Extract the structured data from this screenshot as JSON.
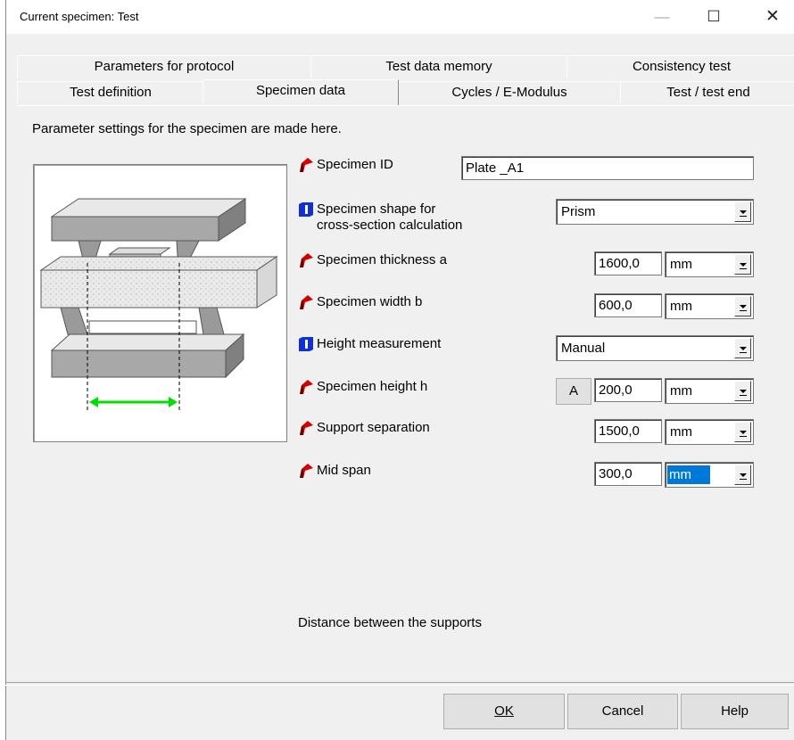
{
  "window": {
    "title": "Current specimen: Test"
  },
  "tabs_back": [
    {
      "label": "Parameters for protocol"
    },
    {
      "label": "Test data memory"
    },
    {
      "label": "Consistency test"
    }
  ],
  "tabs_front": [
    {
      "label": "Test definition"
    },
    {
      "label": "Specimen data"
    },
    {
      "label": "Cycles / E-Modulus"
    },
    {
      "label": "Test / test end"
    }
  ],
  "intro": "Parameter settings for the specimen are made here.",
  "fields": {
    "specimen_id": {
      "label": "Specimen ID",
      "value": "Plate _A1",
      "icon": "red-flag-icon"
    },
    "shape": {
      "label_line1": "Specimen shape for",
      "label_line2": "cross-section calculation",
      "value": "Prism",
      "icon": "blue-info-icon"
    },
    "thickness": {
      "label": "Specimen thickness a",
      "value": "1600,0",
      "unit": "mm",
      "icon": "red-flag-icon"
    },
    "width": {
      "label": "Specimen width b",
      "value": "600,0",
      "unit": "mm",
      "icon": "red-flag-icon"
    },
    "height_measurement": {
      "label": "Height measurement",
      "value": "Manual",
      "icon": "blue-info-icon"
    },
    "height": {
      "label": "Specimen height h",
      "button": "A",
      "value": "200,0",
      "unit": "mm",
      "icon": "red-flag-icon"
    },
    "support": {
      "label": "Support separation",
      "value": "1500,0",
      "unit": "mm",
      "icon": "red-flag-icon"
    },
    "mid_span": {
      "label": "Mid span",
      "value": "300,0",
      "unit": "mm",
      "icon": "red-flag-icon"
    }
  },
  "hint": "Distance between the supports",
  "buttons": {
    "ok": "OK",
    "cancel": "Cancel",
    "help": "Help"
  },
  "colors": {
    "accent": "#0078d7",
    "flag": "#d40000",
    "info": "#1030d0",
    "arrow": "#00e000"
  }
}
